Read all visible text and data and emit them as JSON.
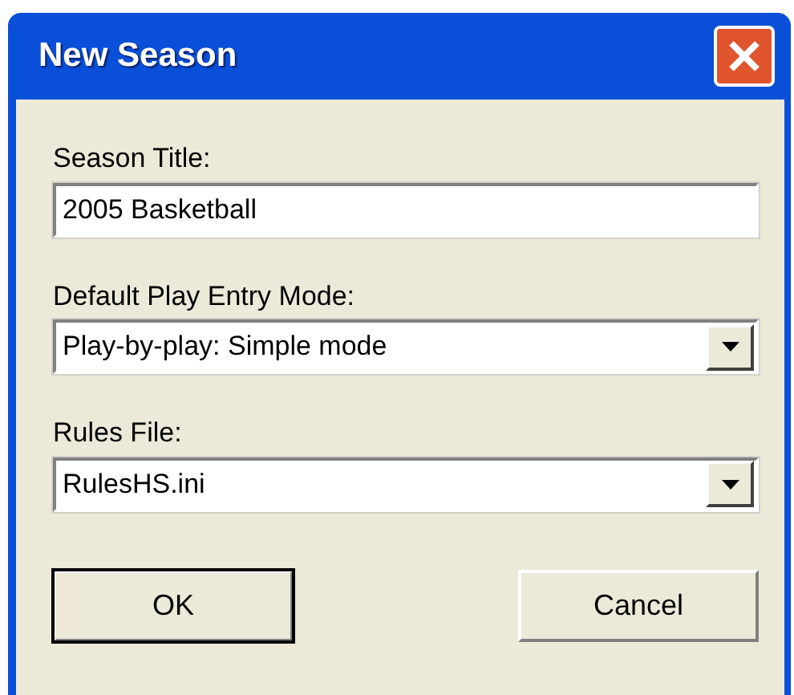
{
  "window": {
    "title": "New Season"
  },
  "fields": [
    {
      "kind": "text",
      "label": "Season Title:",
      "value": "2005 Basketball"
    },
    {
      "kind": "dropdown",
      "label": "Default Play Entry Mode:",
      "value": "Play-by-play: Simple mode"
    },
    {
      "kind": "dropdown",
      "label": "Rules File:",
      "value": "RulesHS.ini"
    }
  ],
  "buttons": [
    {
      "label": "OK",
      "default": true
    },
    {
      "label": "Cancel",
      "default": false
    }
  ]
}
